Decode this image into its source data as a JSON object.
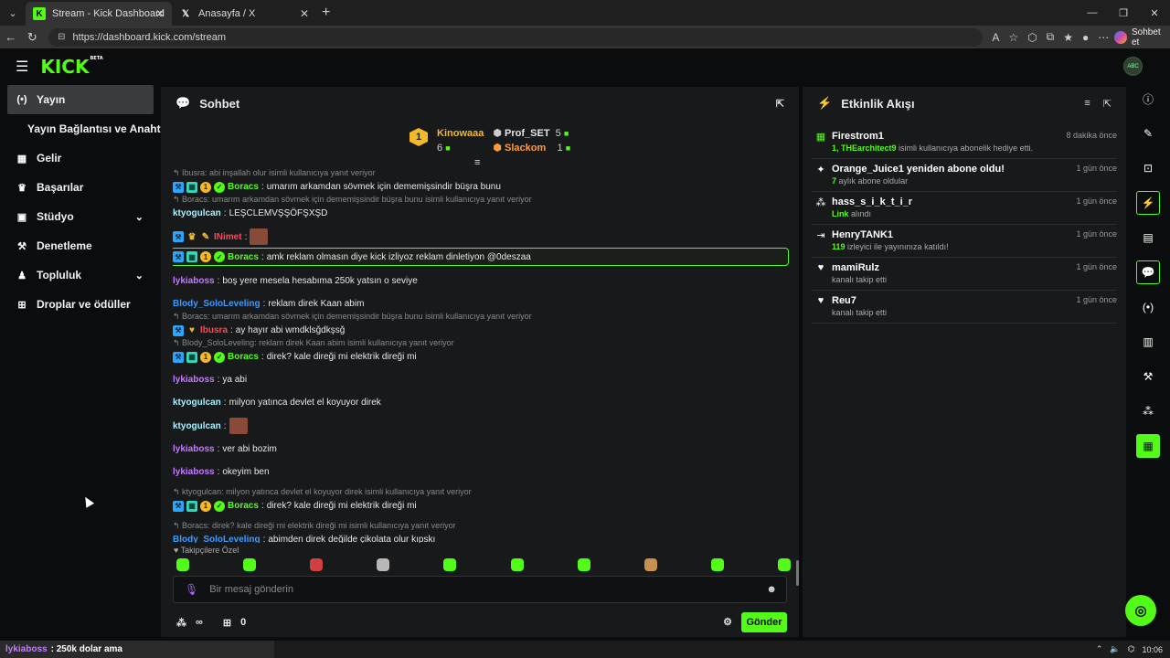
{
  "browser": {
    "tabs": [
      {
        "title": "Stream - Kick Dashboard",
        "active": true
      },
      {
        "title": "Anasayfa / X",
        "active": false
      }
    ],
    "url": "https://dashboard.kick.com/stream",
    "copilot_label": "Sohbet et"
  },
  "app": {
    "logo": "KICK",
    "logo_badge": "BETA",
    "avatar_text": "ABC"
  },
  "sidebar": {
    "items": [
      {
        "label": "Yayın",
        "icon": "broadcast-icon",
        "active": true
      },
      {
        "label": "Yayın Bağlantısı ve Anahtarı",
        "sub": true
      },
      {
        "label": "Gelir",
        "icon": "revenue-icon"
      },
      {
        "label": "Başarılar",
        "icon": "trophy-icon"
      },
      {
        "label": "Stüdyo",
        "icon": "studio-icon",
        "expandable": true
      },
      {
        "label": "Denetleme",
        "icon": "wrench-icon"
      },
      {
        "label": "Topluluk",
        "icon": "community-icon",
        "expandable": true
      },
      {
        "label": "Droplar ve ödüller",
        "icon": "drops-icon"
      }
    ]
  },
  "chat": {
    "title": "Sohbet",
    "leaderboard": {
      "first": {
        "name": "Kinowaaa",
        "count": "6",
        "rank": "1"
      },
      "second": {
        "name": "Prof_SET",
        "count": "5"
      },
      "third": {
        "name": "Slackom",
        "count": "1"
      }
    },
    "messages": [
      {
        "reply": "↰ Ibusra: abi inşallah olur isimli kullanıcıya yanıt veriyor",
        "badges": [
          "blue",
          "teal",
          "gold",
          "green"
        ],
        "user": "Boracs",
        "color": "green",
        "text": "umarım arkamdan sövmek için dememişsindir büşra bunu"
      },
      {
        "reply": "↰ Boracs: umarım arkamdan sövmek için dememişsindir büşra bunu isimli kullanıcıya yanıt veriyor",
        "user": "ktyogulcan",
        "color": "ice",
        "text": "LEŞCLEMVŞŞÖFŞXŞD"
      },
      {
        "badges": [
          "blue",
          "crown",
          "pen"
        ],
        "user": "INimet",
        "color": "red",
        "text": "",
        "emote": true,
        "gap": true
      },
      {
        "badges": [
          "blue",
          "teal",
          "gold",
          "green"
        ],
        "user": "Boracs",
        "color": "green",
        "text": "amk reklam olmasın diye kick izliyoz reklam dinletiyon @0deszaa",
        "highlight": true
      },
      {
        "user": "lykiaboss",
        "color": "purple",
        "text": "boş yere mesela hesabıma 250k yatsın o seviye",
        "gap": true
      },
      {
        "user": "Blody_SoloLeveling",
        "color": "blue",
        "text": "reklam direk Kaan abim",
        "gap": true
      },
      {
        "reply": "↰ Boracs: umarım arkamdan sövmek için dememişsindir büşra bunu isimli kullanıcıya yanıt veriyor",
        "badges": [
          "blue",
          "heart"
        ],
        "user": "Ibusra",
        "color": "red",
        "text": "ay hayır abi wmdklsğdkşsğ"
      },
      {
        "reply": "↰ Blody_SoloLeveling: reklam direk Kaan abim isimli kullanıcıya yanıt veriyor",
        "badges": [
          "blue",
          "teal",
          "gold",
          "green"
        ],
        "user": "Boracs",
        "color": "green",
        "text": "direk? kale direği mi elektrik direği mi"
      },
      {
        "user": "lykiaboss",
        "color": "purple",
        "text": "ya abi",
        "gap": true
      },
      {
        "user": "ktyogulcan",
        "color": "ice",
        "text": "milyon yatınca devlet el koyuyor direk",
        "gap": true
      },
      {
        "user": "ktyogulcan",
        "color": "ice",
        "text": "",
        "emote": true,
        "gap": true
      },
      {
        "user": "lykiaboss",
        "color": "purple",
        "text": "ver abi bozim",
        "gap": true
      },
      {
        "user": "lykiaboss",
        "color": "purple",
        "text": "okeyim ben",
        "gap": true
      },
      {
        "reply": "↰ ktyogulcan: milyon yatınca devlet el koyuyor direk isimli kullanıcıya yanıt veriyor",
        "badges": [
          "blue",
          "teal",
          "gold",
          "green"
        ],
        "user": "Boracs",
        "color": "green",
        "text": "direk? kale direği mi elektrik direği mi",
        "gap": true
      },
      {
        "reply": "↰ Boracs: direk? kale direği mi elektrik direği mi isimli kullanıcıya yanıt veriyor",
        "user": "Blody_SoloLeveling",
        "color": "blue",
        "text": "abimden direk değilde çikolata olur kıpskı",
        "gap": true
      },
      {
        "user": "lykiaboss",
        "color": "purple",
        "text": "250k dolar ama",
        "gap": true
      }
    ],
    "emote_section": "♥ Takipçilere Özel",
    "input_placeholder": "Bir mesaj gönderin",
    "viewers": "∞",
    "points": "0",
    "send_label": "Gönder"
  },
  "activity": {
    "title": "Etkinlik Akışı",
    "items": [
      {
        "icon": "gift-icon",
        "name": "Firestrom1",
        "highlight": "1, THEarchitect9",
        "desc": " isimli kullanıcıya abonelik hediye etti.",
        "time": "8 dakika önce"
      },
      {
        "icon": "star-icon",
        "name": "Orange_Juice1 yeniden abone oldu!",
        "highlight": "7",
        "desc": " aylık abone oldular",
        "time": "1 gün önce"
      },
      {
        "icon": "points-icon",
        "name": "hass_s_i_k_t_i_r",
        "highlight": "Link",
        "desc": " alındı",
        "time": "1 gün önce"
      },
      {
        "icon": "host-icon",
        "name": "HenryTANK1",
        "highlight": "119",
        "desc": " izleyici ile yayınınıza katıldı!",
        "time": "1 gün önce"
      },
      {
        "icon": "heart-icon",
        "name": "mamiRulz",
        "highlight": "",
        "desc": "kanalı takip etti",
        "time": "1 gün önce"
      },
      {
        "icon": "heart-icon",
        "name": "Reu7",
        "highlight": "",
        "desc": "kanalı takip etti",
        "time": "1 gün önce"
      }
    ]
  },
  "taskbar": {
    "preview_user": "lykiaboss",
    "preview_text": ": 250k dolar ama",
    "clock": "10:06"
  },
  "colors": {
    "accent": "#53fc18",
    "panel": "#18191b",
    "background": "#0b0c0d"
  }
}
